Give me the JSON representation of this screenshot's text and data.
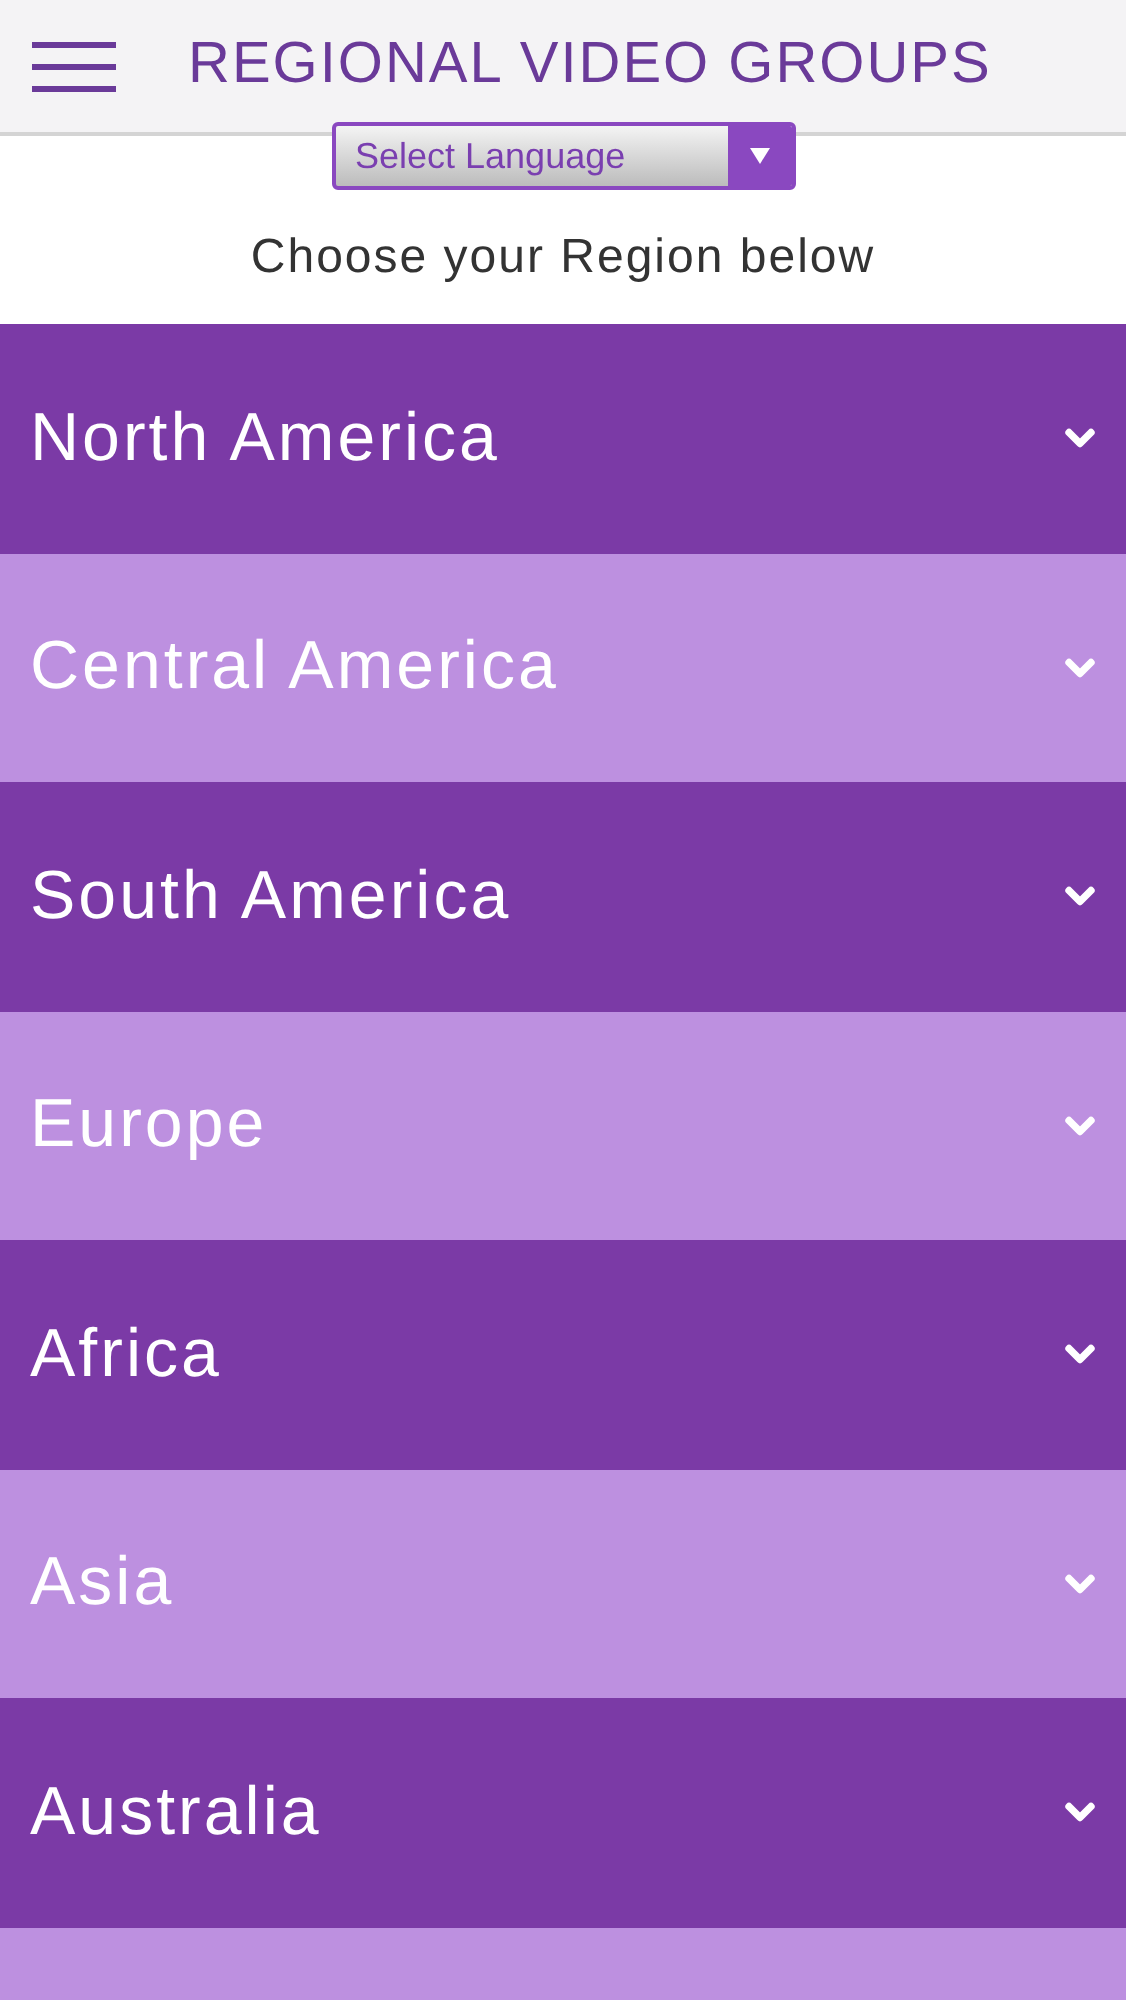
{
  "header": {
    "title": "REGIONAL VIDEO GROUPS"
  },
  "language_select": {
    "value": "Select Language"
  },
  "prompt": "Choose your Region below",
  "regions": [
    {
      "label": "North America",
      "expanded": false
    },
    {
      "label": "Central America",
      "expanded": false
    },
    {
      "label": "South America",
      "expanded": false
    },
    {
      "label": "Europe",
      "expanded": false
    },
    {
      "label": "Africa",
      "expanded": false
    },
    {
      "label": "Asia",
      "expanded": false
    },
    {
      "label": "Australia",
      "expanded": false
    }
  ]
}
